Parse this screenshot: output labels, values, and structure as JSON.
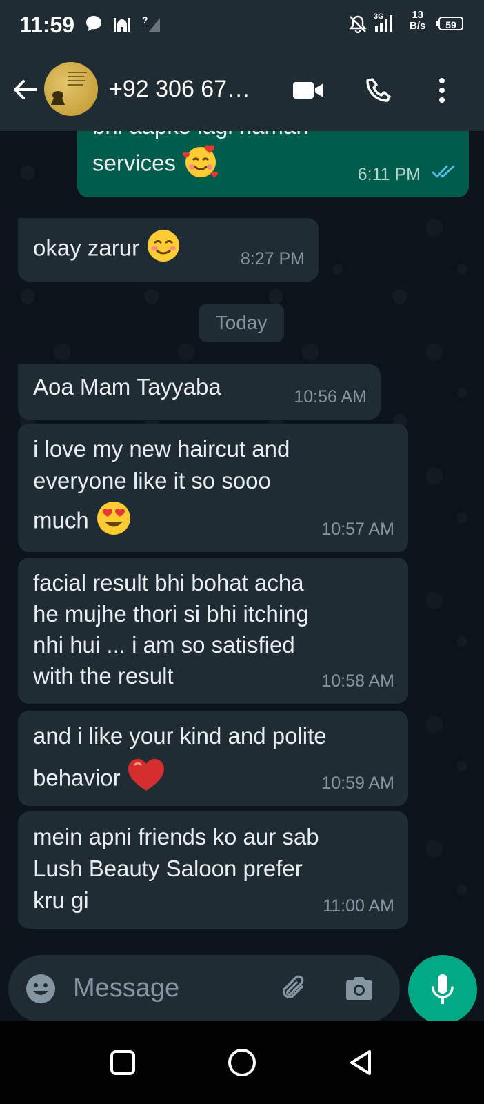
{
  "status_bar": {
    "time": "11:59",
    "net_speed_value": "13",
    "net_speed_unit": "B/s",
    "network_type": "3G",
    "battery": "59",
    "icons": [
      "chat-bubble-icon",
      "mosque-icon",
      "no-signal-icon",
      "mute-icon",
      "signal-icon",
      "battery-icon"
    ]
  },
  "header": {
    "contact_name": "+92 306 67…",
    "icons": [
      "back-arrow-icon",
      "video-call-icon",
      "phone-call-icon",
      "more-options-icon"
    ]
  },
  "chat": {
    "partial_message": {
      "text_top": "bhi aapko lagi hamari",
      "text": "services",
      "emoji": "smiling-face-with-hearts",
      "time": "6:11 PM",
      "status": "read"
    },
    "messages_before": [
      {
        "text": "okay zarur",
        "emoji": "smiling-face-blushing",
        "time": "8:27 PM",
        "direction": "in"
      }
    ],
    "date_separator": "Today",
    "messages": [
      {
        "lines": [
          "Aoa Mam Tayyaba"
        ],
        "time": "10:56 AM",
        "direction": "in"
      },
      {
        "lines": [
          "i love my new haircut and",
          "everyone like it so sooo",
          "much"
        ],
        "emoji": "heart-eyes",
        "time": "10:57 AM",
        "direction": "in"
      },
      {
        "lines": [
          "facial result bhi bohat acha",
          "he mujhe thori si bhi itching",
          "nhi hui ... i am so satisfied",
          "with the result"
        ],
        "time": "10:58 AM",
        "direction": "in"
      },
      {
        "lines": [
          "and i like your kind and polite",
          "behavior"
        ],
        "emoji": "red-heart",
        "time": "10:59 AM",
        "direction": "in"
      },
      {
        "lines": [
          "mein apni friends ko aur sab",
          "Lush Beauty Saloon prefer",
          "kru gi"
        ],
        "time": "11:00 AM",
        "direction": "in"
      }
    ]
  },
  "input": {
    "placeholder": "Message",
    "icons": [
      "emoji-icon",
      "attach-icon",
      "camera-icon",
      "mic-icon"
    ]
  },
  "nav": {
    "icons": [
      "recents-icon",
      "home-icon",
      "back-icon"
    ]
  },
  "colors": {
    "header_bg": "#1f2c34",
    "chat_bg": "#0b141a",
    "incoming_bubble": "#202c33",
    "outgoing_bubble": "#005c4b",
    "accent": "#00a884",
    "read_ticks": "#53bdeb"
  }
}
